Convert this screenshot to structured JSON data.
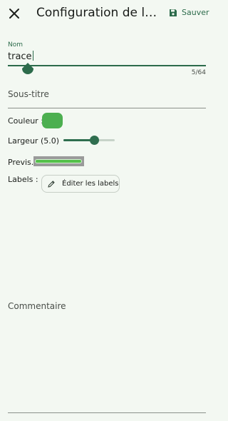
{
  "header": {
    "title": "Configuration de la tr…",
    "save_label": "Sauver"
  },
  "name_field": {
    "label": "Nom",
    "value": "trace",
    "counter": "5/64"
  },
  "subtitle_field": {
    "placeholder": "Sous-titre"
  },
  "color_row": {
    "label": "Couleur :",
    "color": "#4caf50"
  },
  "width_row": {
    "label": "Largeur (5.0)",
    "value": 5.0,
    "slider_fraction": 0.6
  },
  "preview_row": {
    "label": "Previs."
  },
  "labels_row": {
    "label": "Labels :",
    "button_label": "Éditer les labels"
  },
  "comment_field": {
    "placeholder": "Commentaire"
  },
  "colors": {
    "accent": "#2c6b4b",
    "background": "#f3f8f2",
    "line_preview": "#54c04a"
  }
}
